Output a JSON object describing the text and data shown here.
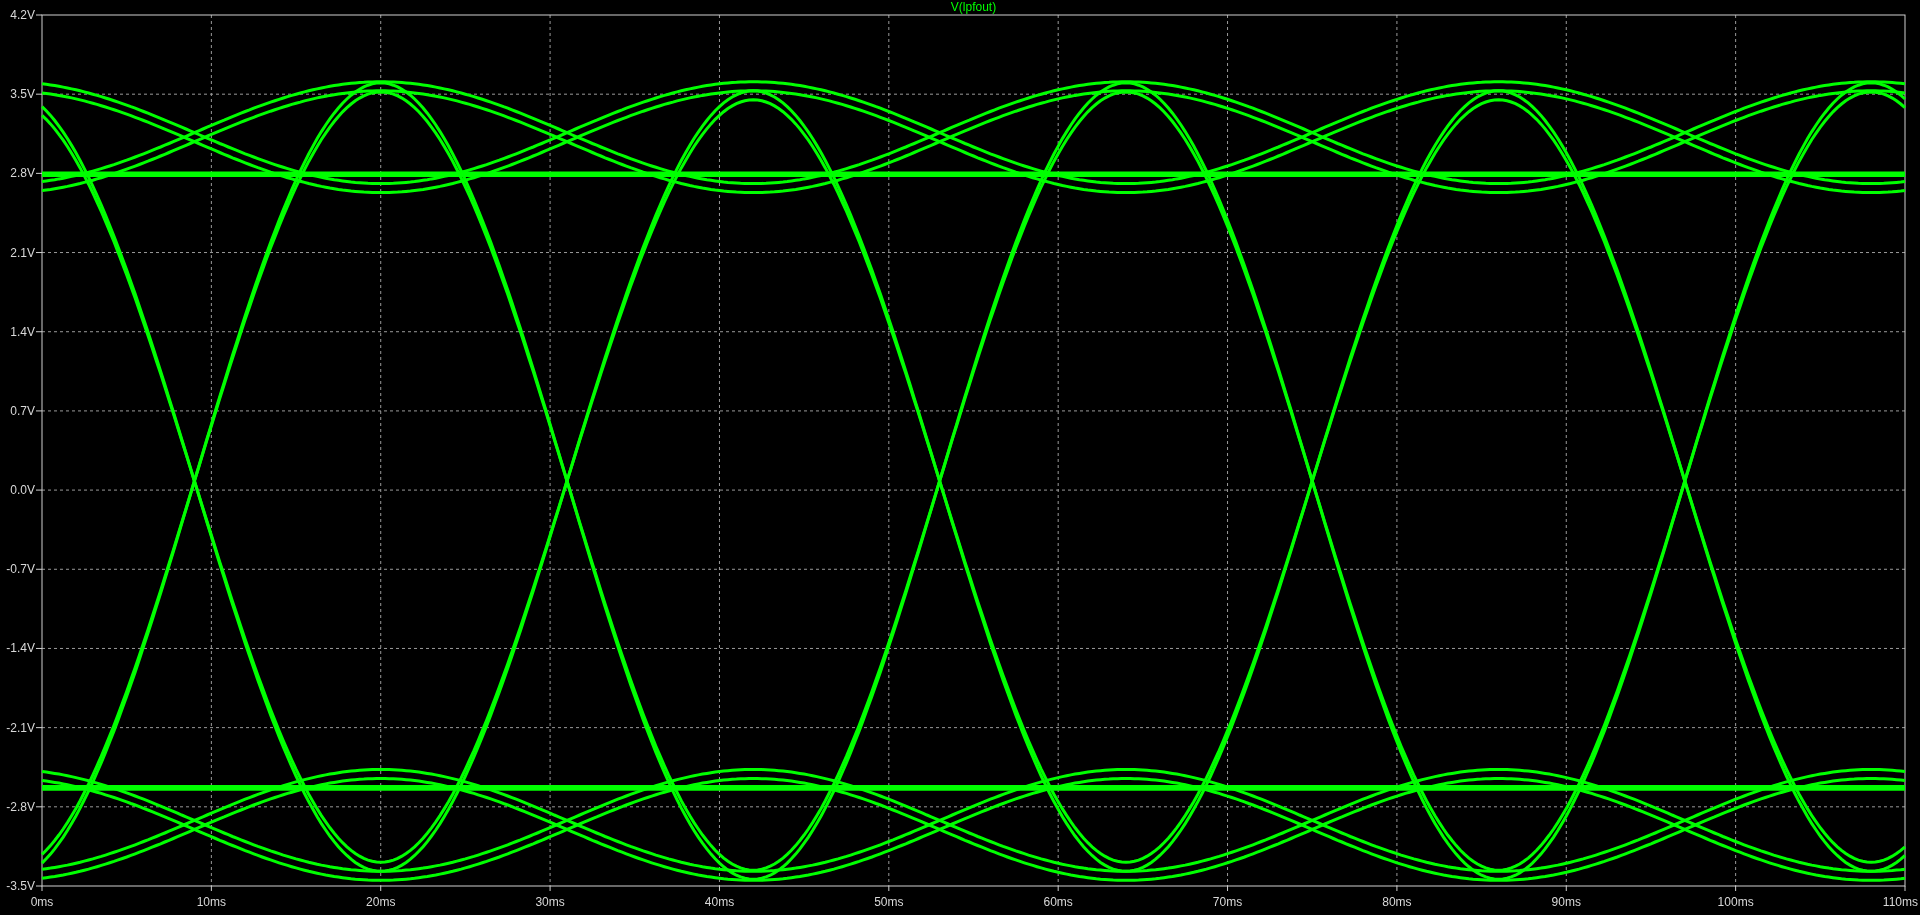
{
  "plot": {
    "title": "V(lpfout)",
    "y_tick_labels": [
      "4.2V",
      "3.5V",
      "2.8V",
      "2.1V",
      "1.4V",
      "0.7V",
      "0.0V",
      "-0.7V",
      "-1.4V",
      "-2.1V",
      "-2.8V",
      "-3.5V"
    ],
    "x_tick_labels": [
      "0ms",
      "10ms",
      "20ms",
      "30ms",
      "40ms",
      "50ms",
      "60ms",
      "70ms",
      "80ms",
      "90ms",
      "100ms",
      "110ms"
    ]
  }
}
